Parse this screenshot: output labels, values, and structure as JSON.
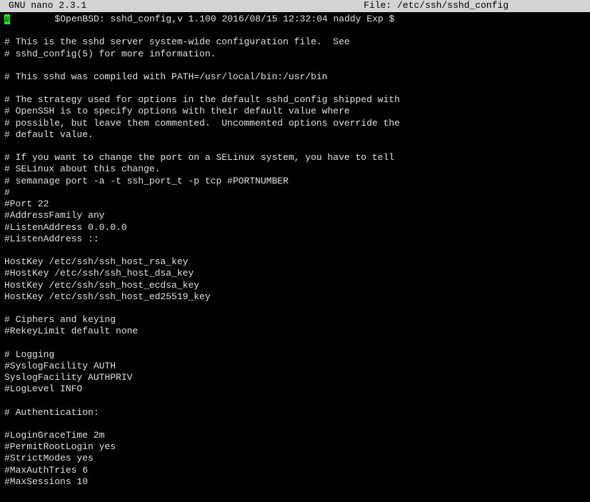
{
  "titlebar": {
    "app": "  GNU nano 2.3.1",
    "file": "File: /etc/ssh/sshd_config"
  },
  "lines": {
    "l0": "",
    "l1": "        $OpenBSD: sshd_config,v 1.100 2016/08/15 12:32:04 naddy Exp $",
    "l2": "",
    "l3": "# This is the sshd server system-wide configuration file.  See",
    "l4": "# sshd_config(5) for more information.",
    "l5": "",
    "l6": "# This sshd was compiled with PATH=/usr/local/bin:/usr/bin",
    "l7": "",
    "l8": "# The strategy used for options in the default sshd_config shipped with",
    "l9": "# OpenSSH is to specify options with their default value where",
    "l10": "# possible, but leave them commented.  Uncommented options override the",
    "l11": "# default value.",
    "l12": "",
    "l13": "# If you want to change the port on a SELinux system, you have to tell",
    "l14": "# SELinux about this change.",
    "l15": "# semanage port -a -t ssh_port_t -p tcp #PORTNUMBER",
    "l16": "#",
    "l17": "#Port 22",
    "l18": "#AddressFamily any",
    "l19": "#ListenAddress 0.0.0.0",
    "l20": "#ListenAddress ::",
    "l21": "",
    "l22": "HostKey /etc/ssh/ssh_host_rsa_key",
    "l23": "#HostKey /etc/ssh/ssh_host_dsa_key",
    "l24": "HostKey /etc/ssh/ssh_host_ecdsa_key",
    "l25": "HostKey /etc/ssh/ssh_host_ed25519_key",
    "l26": "",
    "l27": "# Ciphers and keying",
    "l28": "#RekeyLimit default none",
    "l29": "",
    "l30": "# Logging",
    "l31": "#SyslogFacility AUTH",
    "l32": "SyslogFacility AUTHPRIV",
    "l33": "#LogLevel INFO",
    "l34": "",
    "l35": "# Authentication:",
    "l36": "",
    "l37": "#LoginGraceTime 2m",
    "l38": "#PermitRootLogin yes",
    "l39": "#StrictModes yes",
    "l40": "#MaxAuthTries 6",
    "l41": "#MaxSessions 10"
  },
  "cursor_char": "#"
}
